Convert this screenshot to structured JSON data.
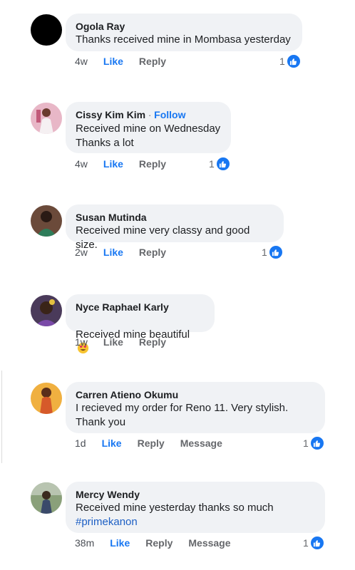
{
  "comments": [
    {
      "name": "Ogola Ray",
      "follow": "",
      "text": "Thanks received mine in Mombasa yesterday",
      "hashtag": "",
      "time": "4w",
      "like": "Like",
      "reply": "Reply",
      "message": "",
      "reactions": "1",
      "avatar_color": "#000000"
    },
    {
      "name": "Cissy Kim Kim",
      "follow": "Follow",
      "text": "Received mine on Wednesday\nThanks a lot",
      "hashtag": "",
      "time": "4w",
      "like": "Like",
      "reply": "Reply",
      "message": "",
      "reactions": "1",
      "avatar_color": "#d98aa6"
    },
    {
      "name": "Susan Mutinda",
      "follow": "",
      "text": "Received mine very classy and good size.",
      "hashtag": "",
      "time": "2w",
      "like": "Like",
      "reply": "Reply",
      "message": "",
      "reactions": "1",
      "avatar_color": "#5b3a2a"
    },
    {
      "name": "Nyce Raphael Karly",
      "follow": "",
      "text": "Received mine beautiful",
      "hashtag": "",
      "time": "1w",
      "like": "Like",
      "reply": "Reply",
      "message": "",
      "reactions": "",
      "avatar_color": "#3c2a4a"
    },
    {
      "name": "Carren Atieno Okumu",
      "follow": "",
      "text": "I recieved my order for Reno 11. Very stylish.\nThank you",
      "hashtag": "",
      "time": "1d",
      "like": "Like",
      "reply": "Reply",
      "message": "Message",
      "reactions": "1",
      "avatar_color": "#e0a030"
    },
    {
      "name": "Mercy Wendy",
      "follow": "",
      "text": "Received mine yesterday thanks so much",
      "hashtag": "#primekanon",
      "time": "38m",
      "like": "Like",
      "reply": "Reply",
      "message": "Message",
      "reactions": "1",
      "avatar_color": "#4a6a4a"
    }
  ],
  "colors": {
    "accent": "#1877f2",
    "bubble": "#f0f2f5",
    "muted": "#65676b"
  },
  "icons": {
    "reaction": "thumbs-up-icon",
    "emoji": "heart-eyes-emoji-icon"
  }
}
